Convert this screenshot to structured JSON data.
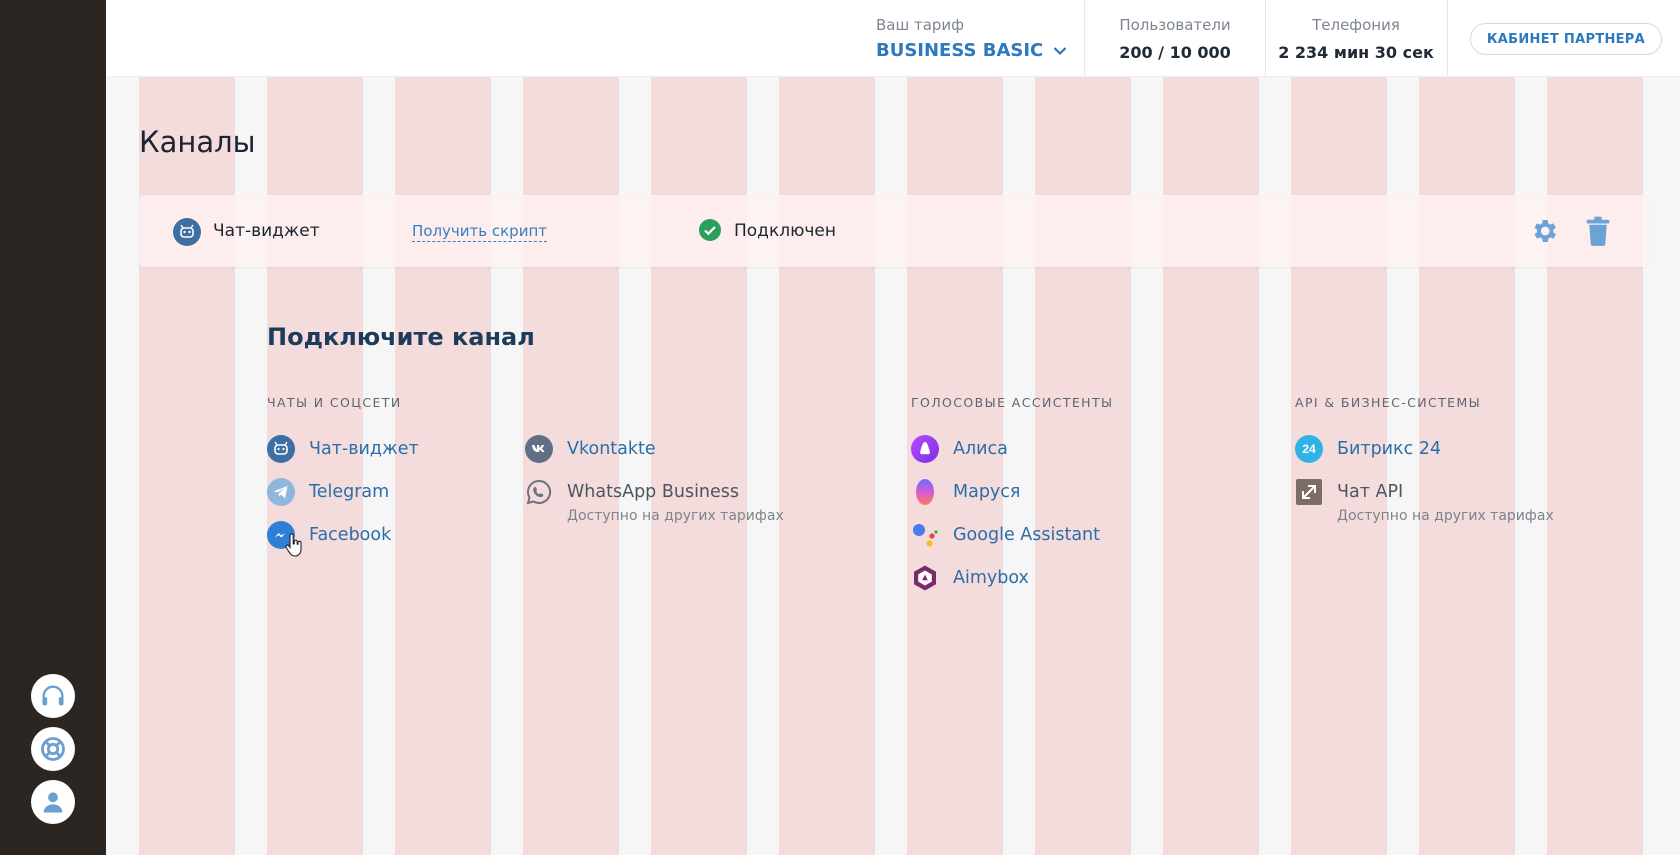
{
  "topbar": {
    "plan_caption": "Ваш тариф",
    "plan_value": "BUSINESS BASIC",
    "users_caption": "Пользователи",
    "users_value": "200 / 10 000",
    "phone_caption": "Телефония",
    "phone_value": "2 234 мин 30 сек",
    "partner_button": "КАБИНЕТ ПАРТНЕРА"
  },
  "page": {
    "title": "Каналы"
  },
  "connected_channel": {
    "name": "Чат-виджет",
    "script_link": "Получить скрипт",
    "status": "Подключен"
  },
  "connect": {
    "title": "Подключите канал",
    "sections": {
      "chats": "ЧАТЫ И СОЦСЕТИ",
      "voice": "ГОЛОСОВЫЕ АССИСТЕНТЫ",
      "api": "API & БИЗНЕС-СИСТЕМЫ"
    },
    "chats_col1": [
      {
        "label": "Чат-виджет",
        "icon": "chat-widget-icon"
      },
      {
        "label": "Telegram",
        "icon": "telegram-icon"
      },
      {
        "label": "Facebook",
        "icon": "messenger-icon"
      }
    ],
    "chats_col2": [
      {
        "label": "Vkontakte",
        "icon": "vk-icon"
      },
      {
        "label": "WhatsApp Business",
        "sub": "Доступно на других тарифах",
        "icon": "whatsapp-icon"
      }
    ],
    "voice": [
      {
        "label": "Алиса",
        "icon": "alice-icon"
      },
      {
        "label": "Маруся",
        "icon": "marusya-icon"
      },
      {
        "label": "Google Assistant",
        "icon": "google-assistant-icon"
      },
      {
        "label": "Aimybox",
        "icon": "aimybox-icon"
      }
    ],
    "api": [
      {
        "label": "Битрикс 24",
        "icon": "bitrix24-icon",
        "badge": "24"
      },
      {
        "label": "Чат API",
        "sub": "Доступно на других тарифах",
        "icon": "chat-api-icon"
      }
    ]
  },
  "colors": {
    "accent": "#2d79bd",
    "rail": "#2b2622",
    "grid_overlay": "#f5dcdc",
    "status_ok": "#2aa05a"
  }
}
